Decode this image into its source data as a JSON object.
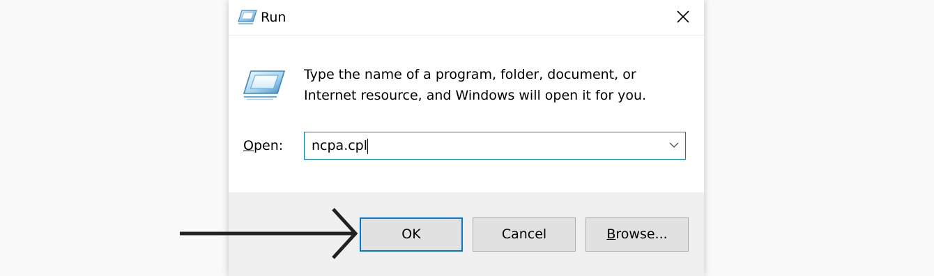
{
  "window": {
    "title": "Run",
    "icon": "run-icon",
    "close_icon": "close-icon"
  },
  "body": {
    "description_line1": "Type the name of a program, folder, document, or",
    "description_line2": "Internet resource, and Windows will open it for you.",
    "open_label_accesskey": "O",
    "open_label_rest": "pen:",
    "open_value": "ncpa.cpl",
    "dropdown_icon": "chevron-down-icon"
  },
  "buttons": {
    "ok_label": "OK",
    "cancel_label": "Cancel",
    "browse_accesskey": "B",
    "browse_rest": "rowse..."
  },
  "annotation": {
    "arrow_target": "ok-button",
    "arrow_color": "#222222"
  },
  "colors": {
    "accent": "#0078d7",
    "button_face": "#e1e1e1",
    "strip_background": "#f0f0f0"
  }
}
